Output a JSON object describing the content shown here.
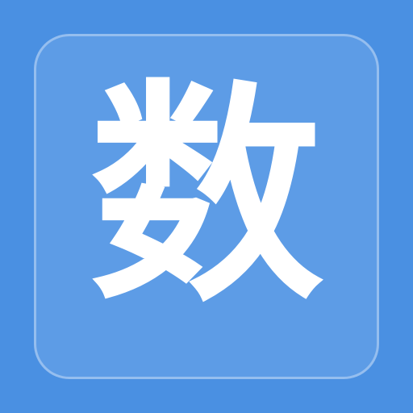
{
  "app_icon": {
    "character": "数",
    "colors": {
      "background": "#4a90e2",
      "tile": "#5d9ce6",
      "tile_border": "rgba(255,255,255,0.35)",
      "glyph": "#ffffff"
    }
  }
}
